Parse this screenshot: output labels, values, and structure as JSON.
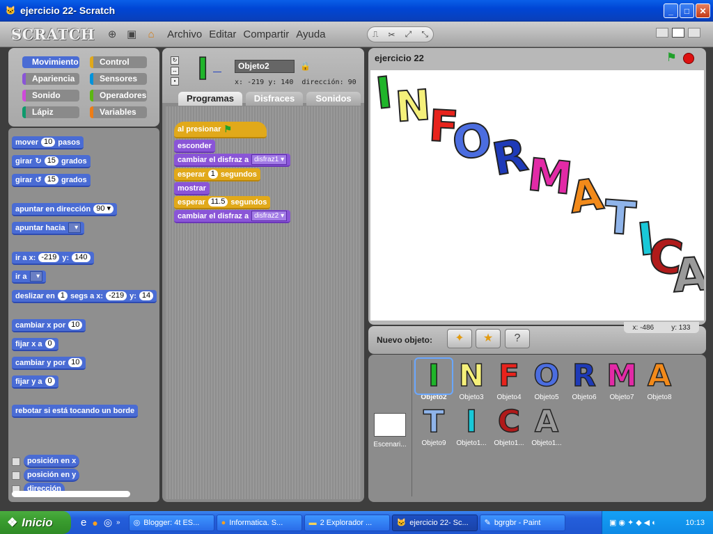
{
  "window": {
    "title": "ejercicio 22- Scratch"
  },
  "menubar": {
    "logo": "SCRATCH",
    "items": [
      "Archivo",
      "Editar",
      "Compartir",
      "Ayuda"
    ]
  },
  "categories": [
    {
      "label": "Movimiento",
      "color": "#4a6cd4"
    },
    {
      "label": "Control",
      "color": "#e1a91a"
    },
    {
      "label": "Apariencia",
      "color": "#8a55d7"
    },
    {
      "label": "Sensores",
      "color": "#0093db"
    },
    {
      "label": "Sonido",
      "color": "#cf4ad9"
    },
    {
      "label": "Operadores",
      "color": "#5cb712"
    },
    {
      "label": "Lápiz",
      "color": "#0e9a6c"
    },
    {
      "label": "Variables",
      "color": "#ee7d16"
    }
  ],
  "palette": {
    "mover": {
      "a": "mover",
      "v": "10",
      "b": "pasos"
    },
    "girar_r": {
      "a": "girar",
      "v": "15",
      "b": "grados"
    },
    "girar_l": {
      "a": "girar",
      "v": "15",
      "b": "grados"
    },
    "apuntar_dir": {
      "a": "apuntar en dirección",
      "v": "90"
    },
    "apuntar_hacia": {
      "a": "apuntar hacia"
    },
    "ir_xy": {
      "a": "ir a x:",
      "x": "-219",
      "b": "y:",
      "y": "140"
    },
    "ir_a": {
      "a": "ir a"
    },
    "deslizar": {
      "a": "deslizar en",
      "v": "1",
      "b": "segs a x:",
      "x": "-219",
      "c": "y:",
      "y": "14"
    },
    "cambiar_x": {
      "a": "cambiar x por",
      "v": "10"
    },
    "fijar_x": {
      "a": "fijar x a",
      "v": "0"
    },
    "cambiar_y": {
      "a": "cambiar y por",
      "v": "10"
    },
    "fijar_y": {
      "a": "fijar y a",
      "v": "0"
    },
    "rebotar": {
      "a": "rebotar si está tocando un borde"
    },
    "reporters": [
      "posición en x",
      "posición en y",
      "dirección"
    ]
  },
  "sprite": {
    "name": "Objeto2",
    "x_label": "x:",
    "x": "-219",
    "y_label": "y:",
    "y": "140",
    "dir_label": "dirección:",
    "dir": "90"
  },
  "tabs": [
    "Programas",
    "Disfraces",
    "Sonidos"
  ],
  "script": {
    "hat": "al presionar",
    "b1": "esconder",
    "b2": {
      "a": "cambiar el disfraz a",
      "v": "disfraz1"
    },
    "b3": {
      "a": "esperar",
      "v": "1",
      "b": "segundos"
    },
    "b4": "mostrar",
    "b5": {
      "a": "esperar",
      "v": "11.5",
      "b": "segundos"
    },
    "b6": {
      "a": "cambiar el disfraz a",
      "v": "disfraz2"
    }
  },
  "stage": {
    "title": "ejercicio 22",
    "letters": [
      "I",
      "N",
      "F",
      "O",
      "R",
      "M",
      "A",
      "T",
      "I",
      "C",
      "A"
    ],
    "letter_colors": [
      "#1fb52a",
      "#f5f07a",
      "#e8231c",
      "#4b6de0",
      "#1e3ab8",
      "#e22aa6",
      "#f28a1a",
      "#8fb4ea",
      "#19c8d8",
      "#b01a1a",
      "#9a9a9a"
    ],
    "readout_x": "x: -486",
    "readout_y": "y: 133"
  },
  "new_object": {
    "label": "Nuevo objeto:"
  },
  "sprite_list": {
    "stage_label": "Escenari...",
    "items": [
      {
        "letter": "I",
        "name": "Objeto2",
        "color": "#1fb52a"
      },
      {
        "letter": "N",
        "name": "Objeto3",
        "color": "#f5f07a"
      },
      {
        "letter": "F",
        "name": "Objeto4",
        "color": "#e8231c"
      },
      {
        "letter": "O",
        "name": "Objeto5",
        "color": "#4b6de0"
      },
      {
        "letter": "R",
        "name": "Objeto6",
        "color": "#1e3ab8"
      },
      {
        "letter": "M",
        "name": "Objeto7",
        "color": "#e22aa6"
      },
      {
        "letter": "A",
        "name": "Objeto8",
        "color": "#f28a1a"
      },
      {
        "letter": "T",
        "name": "Objeto9",
        "color": "#8fb4ea"
      },
      {
        "letter": "I",
        "name": "Objeto1...",
        "color": "#19c8d8"
      },
      {
        "letter": "C",
        "name": "Objeto1...",
        "color": "#b01a1a"
      },
      {
        "letter": "A",
        "name": "Objeto1...",
        "color": "#9a9a9a"
      }
    ]
  },
  "taskbar": {
    "start": "Inicio",
    "tasks": [
      "Blogger: 4t ES...",
      "Informatica. S...",
      "2 Explorador ...",
      "ejercicio 22- Sc...",
      "bgrgbr - Paint"
    ],
    "clock": "10:13"
  }
}
